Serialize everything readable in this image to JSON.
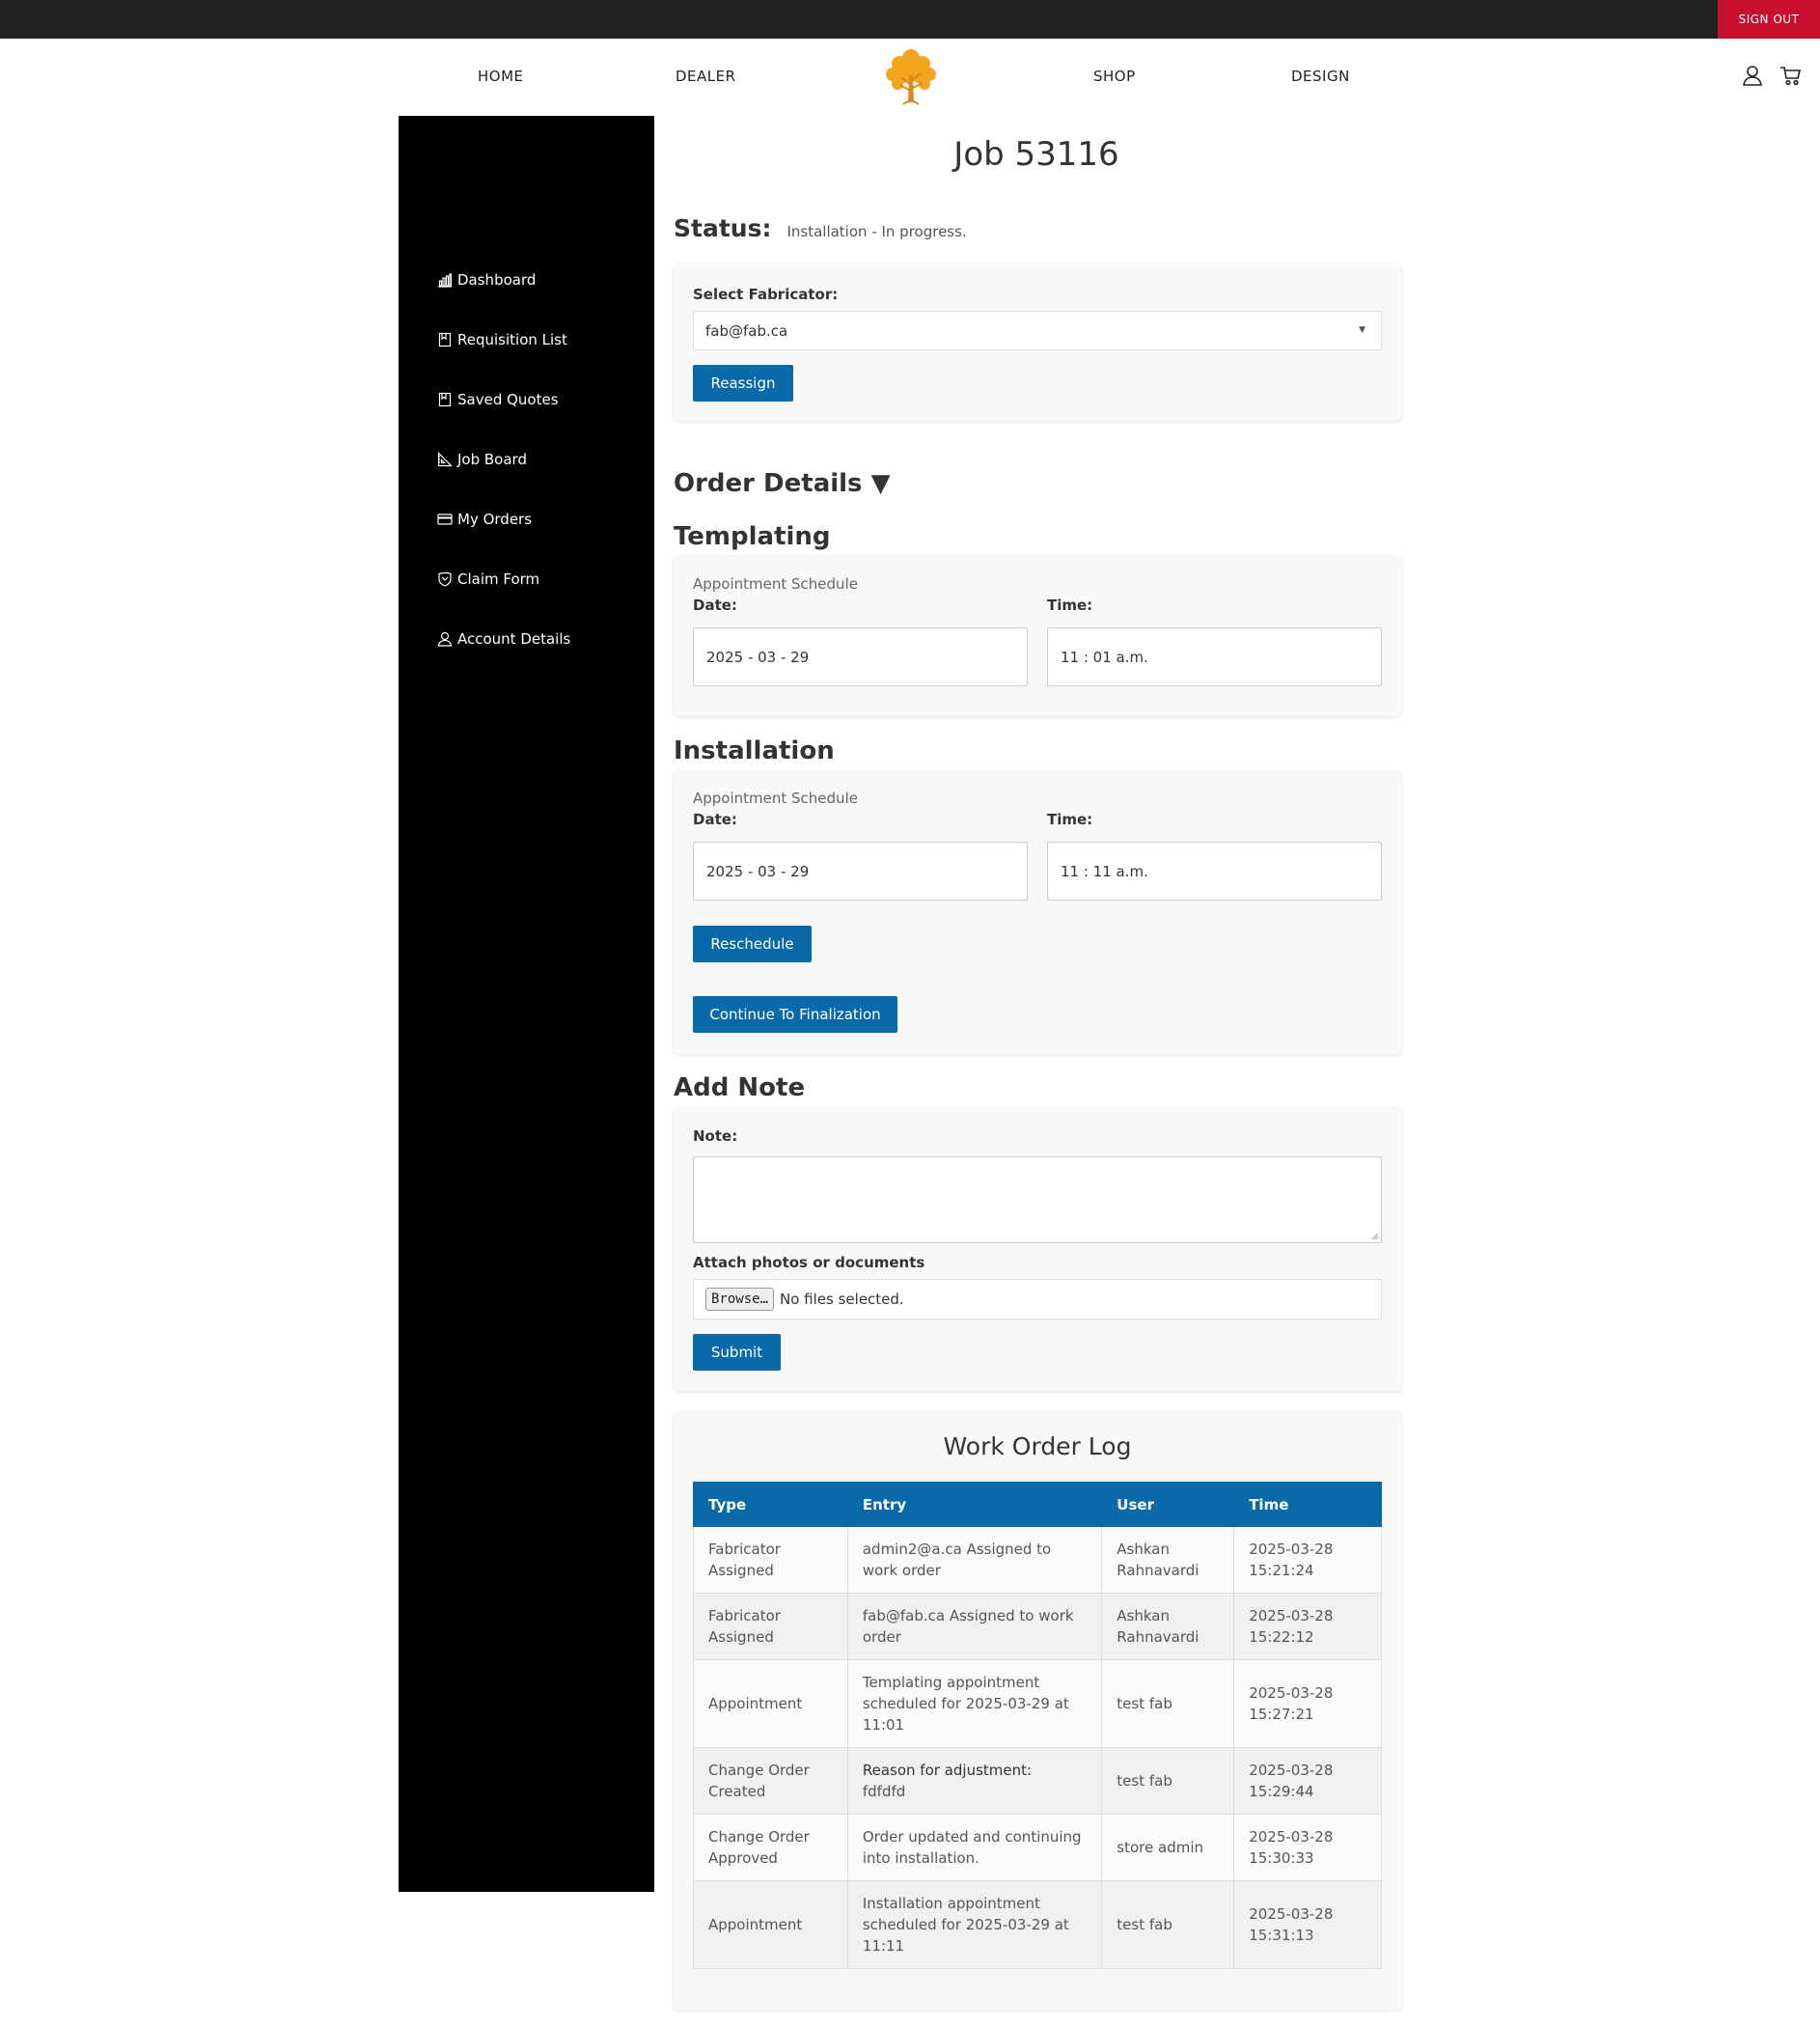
{
  "topbar": {
    "signout_label": "SIGN OUT"
  },
  "nav": {
    "home": "HOME",
    "dealer": "DEALER",
    "shop": "SHOP",
    "design": "DESIGN"
  },
  "icons": {
    "logo": "tree-logo",
    "account": "user-icon",
    "cart": "cart-icon"
  },
  "sidebar": {
    "items": [
      {
        "label": "Dashboard",
        "icon": "bar-chart-icon"
      },
      {
        "label": "Requisition List",
        "icon": "document-icon"
      },
      {
        "label": "Saved Quotes",
        "icon": "document-icon"
      },
      {
        "label": "Job Board",
        "icon": "ruler-triangle-icon"
      },
      {
        "label": "My Orders",
        "icon": "credit-card-icon"
      },
      {
        "label": "Claim Form",
        "icon": "shield-icon"
      },
      {
        "label": "Account Details",
        "icon": "user-icon"
      }
    ]
  },
  "page": {
    "title": "Job 53116",
    "status_label": "Status:",
    "status_value": "Installation - In progress."
  },
  "fabricator": {
    "label": "Select Fabricator:",
    "selected": "fab@fab.ca",
    "reassign_label": "Reassign"
  },
  "order_details": {
    "title": "Order Details ▼"
  },
  "templating": {
    "title": "Templating",
    "schedule_label": "Appointment Schedule",
    "date_label": "Date:",
    "time_label": "Time:",
    "date_value": "2025 - 03 - 29",
    "time_value": "11 : 01  a.m."
  },
  "installation": {
    "title": "Installation",
    "schedule_label": "Appointment Schedule",
    "date_label": "Date:",
    "time_label": "Time:",
    "date_value": "2025 - 03 - 29",
    "time_value": "11 : 11  a.m.",
    "reschedule_label": "Reschedule",
    "continue_label": "Continue To Finalization"
  },
  "note": {
    "title": "Add Note",
    "note_label": "Note:",
    "attach_label": "Attach photos or documents",
    "browse_label": "Browse…",
    "no_files": "No files selected.",
    "submit_label": "Submit"
  },
  "log": {
    "title": "Work Order Log",
    "columns": [
      "Type",
      "Entry",
      "User",
      "Time"
    ],
    "rows": [
      {
        "type": "Fabricator Assigned",
        "entry": "admin2@a.ca Assigned to work order",
        "user": "Ashkan Rahnavardi",
        "time": "2025-03-28 15:21:24"
      },
      {
        "type": "Fabricator Assigned",
        "entry": "fab@fab.ca Assigned to work order",
        "user": "Ashkan Rahnavardi",
        "time": "2025-03-28 15:22:12"
      },
      {
        "type": "Appointment",
        "entry": "Templating appointment scheduled for 2025-03-29 at 11:01",
        "user": "test fab",
        "time": "2025-03-28 15:27:21"
      },
      {
        "type": "Change Order Created",
        "entry_strong": "Reason for adjustment:",
        "entry": "fdfdfd",
        "user": "test fab",
        "time": "2025-03-28 15:29:44"
      },
      {
        "type": "Change Order Approved",
        "entry": "Order updated and continuing into installation.",
        "user": "store admin",
        "time": "2025-03-28 15:30:33"
      },
      {
        "type": "Appointment",
        "entry": "Installation appointment scheduled for 2025-03-29 at 11:11",
        "user": "test fab",
        "time": "2025-03-28 15:31:13"
      }
    ]
  }
}
